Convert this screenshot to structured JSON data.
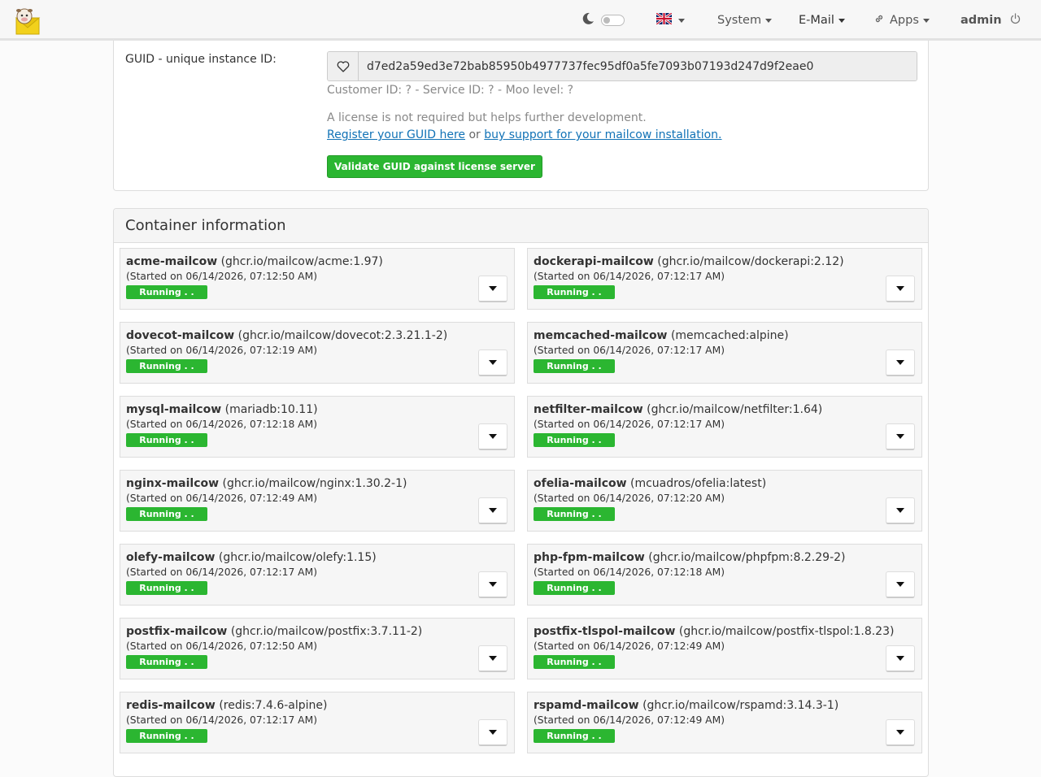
{
  "nav": {
    "items": [
      {
        "label": "System"
      },
      {
        "label": "E-Mail"
      },
      {
        "label": "Apps"
      }
    ],
    "user": "admin",
    "icons": {
      "logo": "mailcow-logo",
      "theme": "moon-icon",
      "language": "uk-flag-icon",
      "apps": "link-icon",
      "logout": "power-icon"
    }
  },
  "license": {
    "guid_label": "GUID - unique instance ID:",
    "guid_value": "d7ed2a59ed3e72bab85950b4977737fec95df0a5fe7093b07193d247d9f2eae0",
    "customer_line": "Customer ID: ? - Service ID: ? - Moo level: ?",
    "info": "A license is not required but helps further development.",
    "register_link": "Register your GUID here",
    "or_text": "or",
    "support_link": "buy support for your mailcow installation.",
    "validate_button": "Validate GUID against license server"
  },
  "containers": {
    "title": "Container information",
    "items": [
      {
        "name": "acme-mailcow",
        "image": "(ghcr.io/mailcow/acme:1.97)",
        "started": "(Started on 06/14/2026, 07:12:50 AM)",
        "status": "Running . ."
      },
      {
        "name": "dockerapi-mailcow",
        "image": "(ghcr.io/mailcow/dockerapi:2.12)",
        "started": "(Started on 06/14/2026, 07:12:17 AM)",
        "status": "Running . ."
      },
      {
        "name": "dovecot-mailcow",
        "image": "(ghcr.io/mailcow/dovecot:2.3.21.1-2)",
        "started": "(Started on 06/14/2026, 07:12:19 AM)",
        "status": "Running . ."
      },
      {
        "name": "memcached-mailcow",
        "image": "(memcached:alpine)",
        "started": "(Started on 06/14/2026, 07:12:17 AM)",
        "status": "Running . ."
      },
      {
        "name": "mysql-mailcow",
        "image": "(mariadb:10.11)",
        "started": "(Started on 06/14/2026, 07:12:18 AM)",
        "status": "Running . ."
      },
      {
        "name": "netfilter-mailcow",
        "image": "(ghcr.io/mailcow/netfilter:1.64)",
        "started": "(Started on 06/14/2026, 07:12:17 AM)",
        "status": "Running . ."
      },
      {
        "name": "nginx-mailcow",
        "image": "(ghcr.io/mailcow/nginx:1.30.2-1)",
        "started": "(Started on 06/14/2026, 07:12:49 AM)",
        "status": "Running . ."
      },
      {
        "name": "ofelia-mailcow",
        "image": "(mcuadros/ofelia:latest)",
        "started": "(Started on 06/14/2026, 07:12:20 AM)",
        "status": "Running . ."
      },
      {
        "name": "olefy-mailcow",
        "image": "(ghcr.io/mailcow/olefy:1.15)",
        "started": "(Started on 06/14/2026, 07:12:17 AM)",
        "status": "Running . ."
      },
      {
        "name": "php-fpm-mailcow",
        "image": "(ghcr.io/mailcow/phpfpm:8.2.29-2)",
        "started": "(Started on 06/14/2026, 07:12:18 AM)",
        "status": "Running . ."
      },
      {
        "name": "postfix-mailcow",
        "image": "(ghcr.io/mailcow/postfix:3.7.11-2)",
        "started": "(Started on 06/14/2026, 07:12:50 AM)",
        "status": "Running . ."
      },
      {
        "name": "postfix-tlspol-mailcow",
        "image": "(ghcr.io/mailcow/postfix-tlspol:1.8.23)",
        "started": "(Started on 06/14/2026, 07:12:49 AM)",
        "status": "Running . ."
      },
      {
        "name": "redis-mailcow",
        "image": "(redis:7.4.6-alpine)",
        "started": "(Started on 06/14/2026, 07:12:17 AM)",
        "status": "Running . ."
      },
      {
        "name": "rspamd-mailcow",
        "image": "(ghcr.io/mailcow/rspamd:3.14.3-1)",
        "started": "(Started on 06/14/2026, 07:12:49 AM)",
        "status": "Running . ."
      }
    ]
  },
  "colors": {
    "running": "#2bb631",
    "link": "#1172b6"
  }
}
